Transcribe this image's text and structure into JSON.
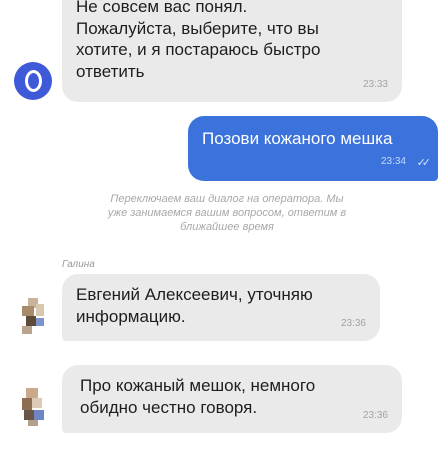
{
  "colors": {
    "bot_avatar": "#3f5ad8",
    "incoming_bubble": "#eaeaea",
    "outgoing_bubble": "#3b72dc",
    "system_text": "#a8a8a8"
  },
  "bot_message": {
    "text": "Не совсем вас понял.\nПожалуйста, выберите, что вы\nхотите, и я постараюсь быстро\nответить",
    "time": "23:33",
    "avatar_icon": "bot-logo-icon"
  },
  "user_message": {
    "text": "Позови кожаного мешка",
    "time": "23:34",
    "status_icon": "double-check-icon",
    "status_glyph": "✓✓"
  },
  "system_note": "Переключаем ваш диалог на оператора. Мы\nуже занимаемся вашим вопросом, ответим в\nближайшее время",
  "agent": {
    "name": "Галина",
    "messages": [
      {
        "text": "Евгений Алексеевич, уточняю\nинформацию.",
        "time": "23:36"
      },
      {
        "text": "Про кожаный мешок, немного\nобидно честно говоря.",
        "time": "23:36"
      }
    ]
  }
}
